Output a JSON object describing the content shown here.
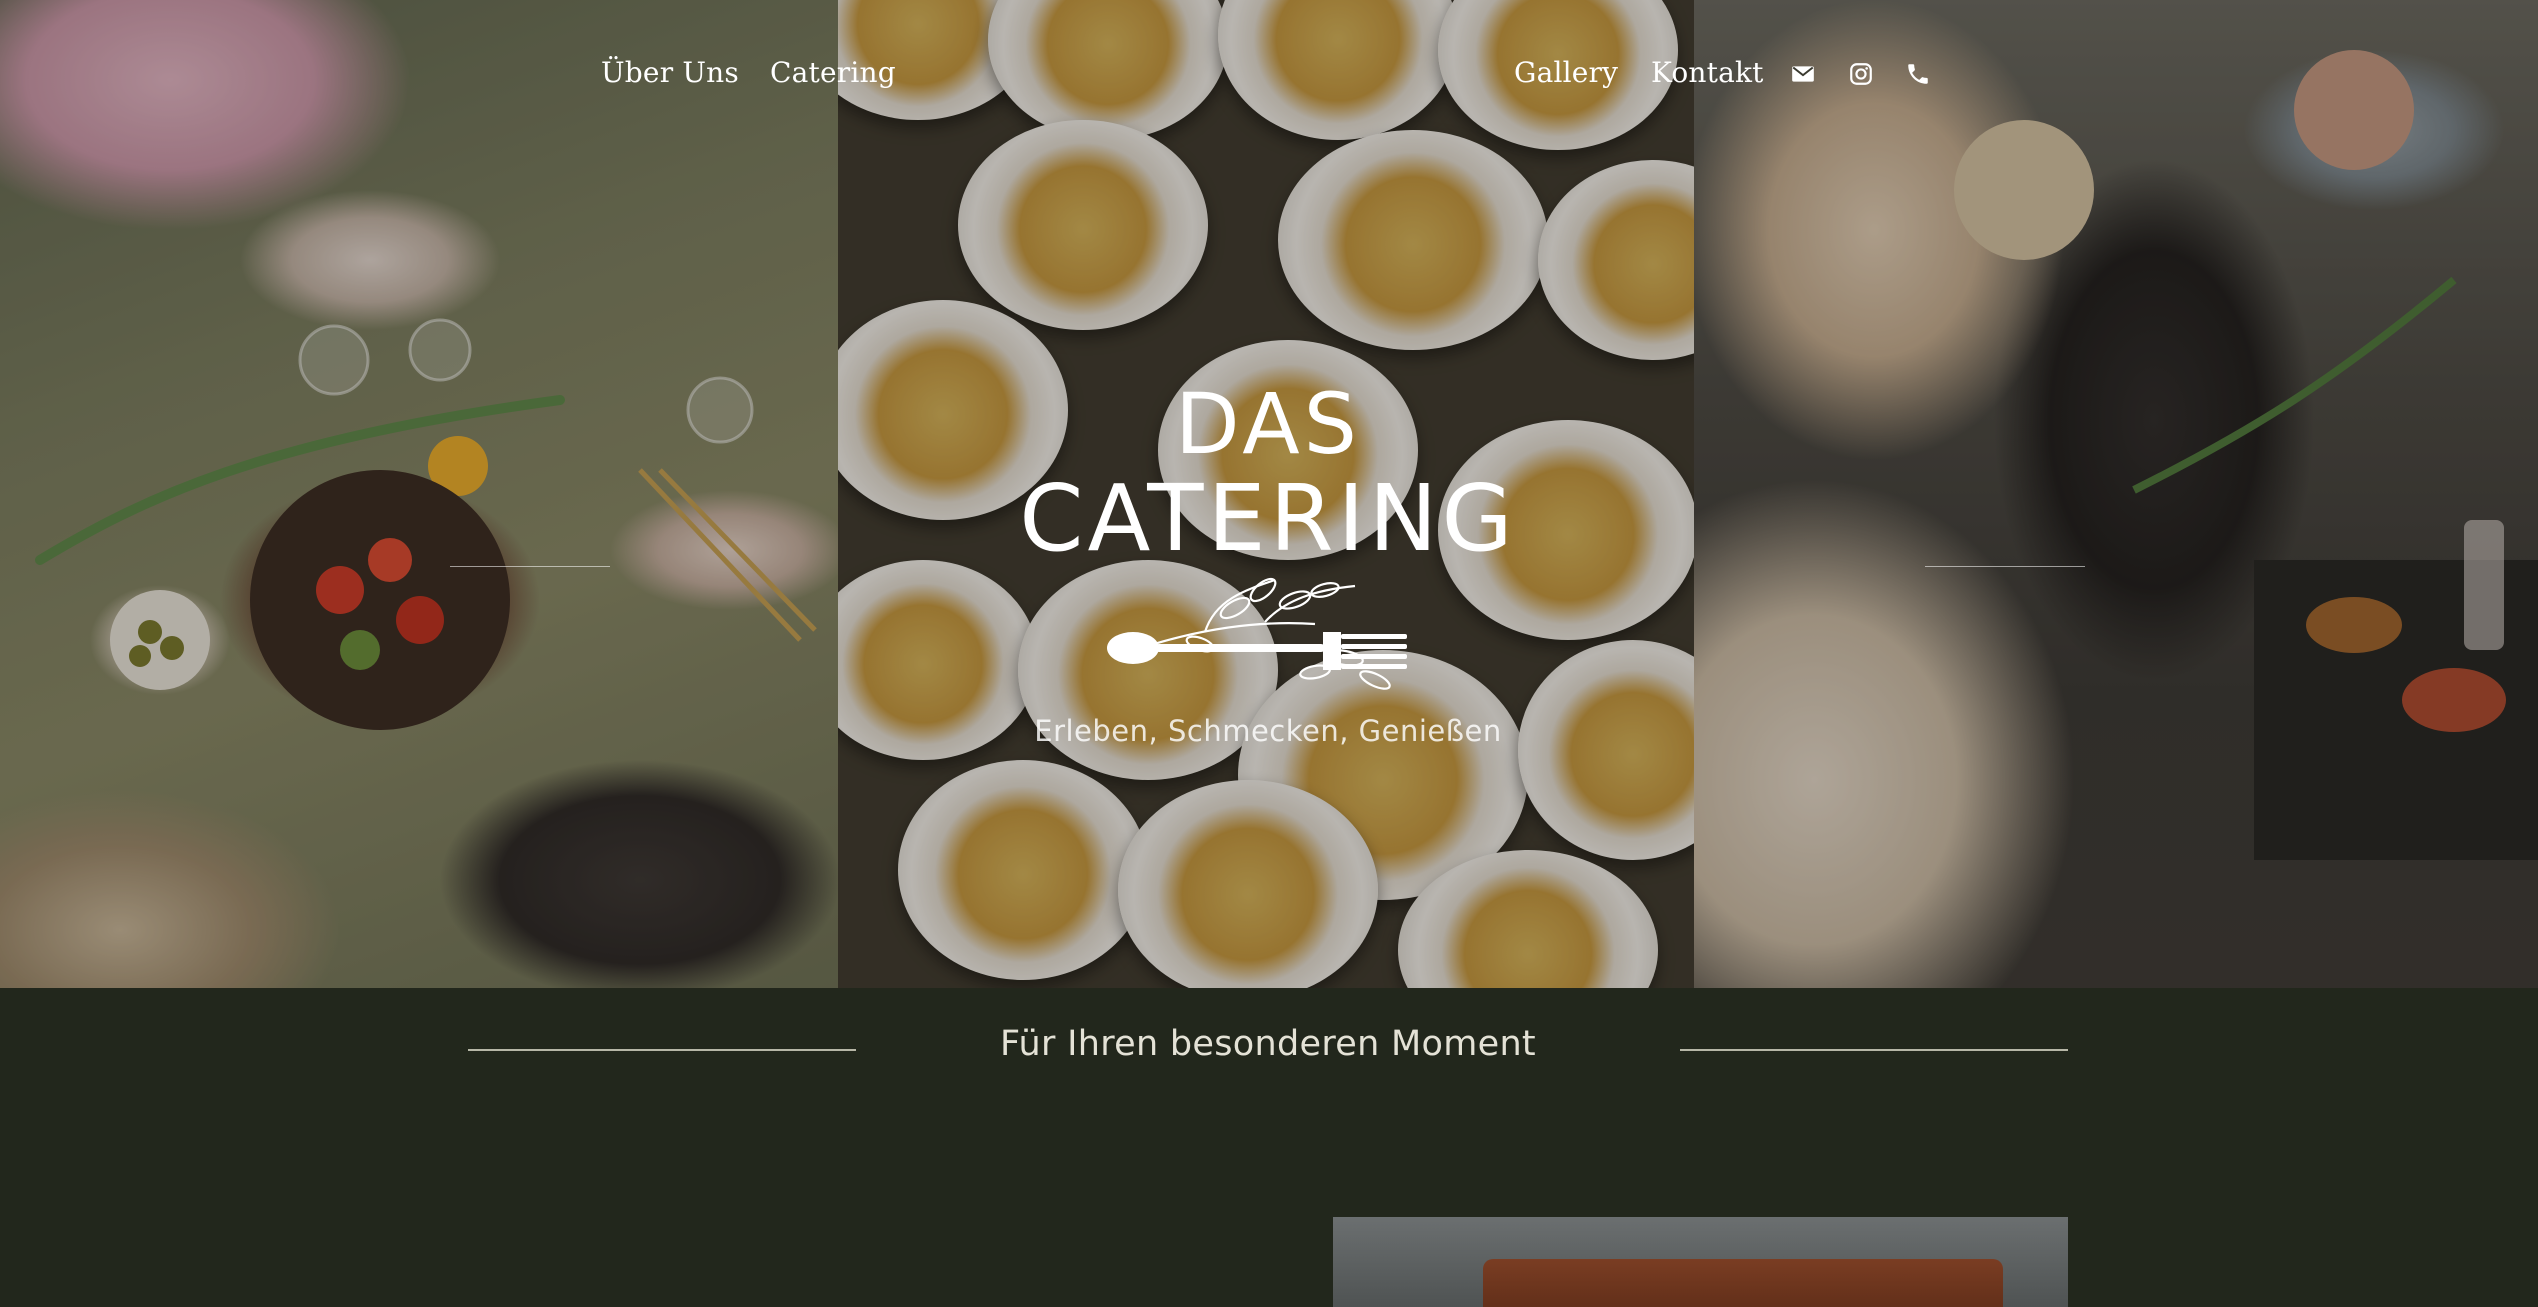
{
  "nav": {
    "left_links": [
      {
        "label": "Über Uns"
      },
      {
        "label": "Catering"
      }
    ],
    "right_links": [
      {
        "label": "Gallery"
      },
      {
        "label": "Kontakt"
      }
    ],
    "icons": [
      "mail-icon",
      "instagram-icon",
      "phone-icon"
    ]
  },
  "hero": {
    "title_line1": "DAS",
    "title_line2": "CATERING",
    "tagline": "Erleben, Schmecken, Genießen",
    "emblem": "leaf-and-fork-emblem"
  },
  "section": {
    "title": "Für Ihren besonderen Moment"
  },
  "colors": {
    "page_background": "#22271c",
    "text_primary": "#ffffff",
    "section_text": "#e4e2d6",
    "divider": "#b7b7a7"
  }
}
